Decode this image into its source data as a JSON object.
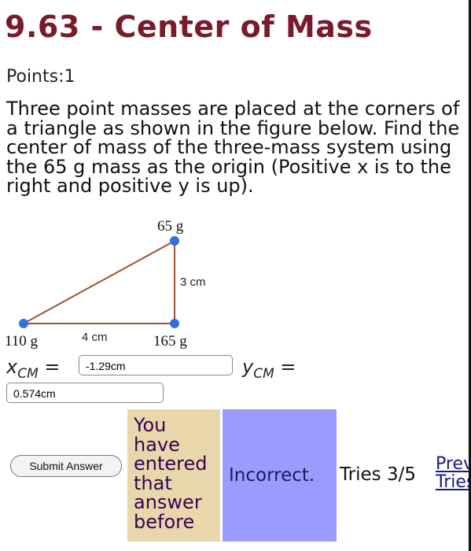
{
  "title": "9.63 - Center of Mass",
  "points": "Points:1",
  "problem_text": "Three point masses are placed at the corners of a triangle as shown in the figure below. Find the center of mass of the three-mass system using the 65 g mass as the origin (Positive x is to the right and positive y is up).",
  "figure": {
    "mass_top": "65 g",
    "mass_left": "110 g",
    "mass_right": "165 g",
    "side_vertical": "3 cm",
    "side_horizontal": "4 cm"
  },
  "xcm": {
    "symbol": "x",
    "subscript": "CM",
    "equals": "=",
    "value": "-1.29cm"
  },
  "ycm": {
    "symbol": "y",
    "subscript": "CM",
    "equals": "=",
    "value": "0.574cm"
  },
  "submit_label": "Submit Answer",
  "previous_message": "You have entered that answer before",
  "status_message": "Incorrect.",
  "tries": "Tries 3/5",
  "previous_tries_link": "Previous Tries",
  "colors": {
    "title": "#7a1a2a",
    "triangle_line": "#a0522d",
    "vertex_dot": "#2f6fe0",
    "previous_bg": "#e7d7aa",
    "incorrect_bg": "#9b9bff"
  }
}
